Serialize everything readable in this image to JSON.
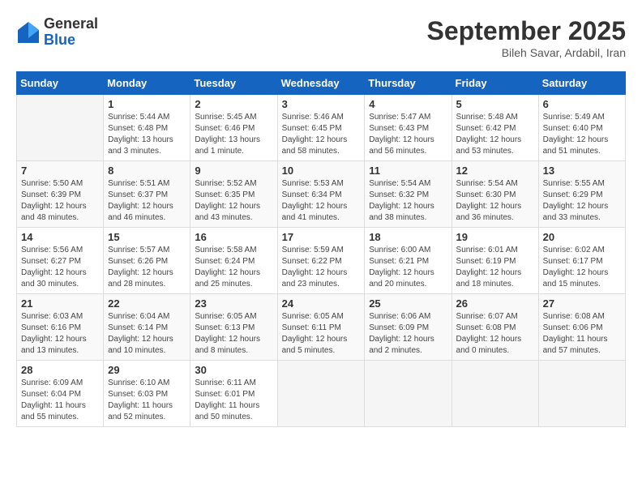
{
  "logo": {
    "general": "General",
    "blue": "Blue"
  },
  "header": {
    "month": "September 2025",
    "location": "Bileh Savar, Ardabil, Iran"
  },
  "weekdays": [
    "Sunday",
    "Monday",
    "Tuesday",
    "Wednesday",
    "Thursday",
    "Friday",
    "Saturday"
  ],
  "weeks": [
    [
      {
        "day": "",
        "info": ""
      },
      {
        "day": "1",
        "info": "Sunrise: 5:44 AM\nSunset: 6:48 PM\nDaylight: 13 hours\nand 3 minutes."
      },
      {
        "day": "2",
        "info": "Sunrise: 5:45 AM\nSunset: 6:46 PM\nDaylight: 13 hours\nand 1 minute."
      },
      {
        "day": "3",
        "info": "Sunrise: 5:46 AM\nSunset: 6:45 PM\nDaylight: 12 hours\nand 58 minutes."
      },
      {
        "day": "4",
        "info": "Sunrise: 5:47 AM\nSunset: 6:43 PM\nDaylight: 12 hours\nand 56 minutes."
      },
      {
        "day": "5",
        "info": "Sunrise: 5:48 AM\nSunset: 6:42 PM\nDaylight: 12 hours\nand 53 minutes."
      },
      {
        "day": "6",
        "info": "Sunrise: 5:49 AM\nSunset: 6:40 PM\nDaylight: 12 hours\nand 51 minutes."
      }
    ],
    [
      {
        "day": "7",
        "info": "Sunrise: 5:50 AM\nSunset: 6:39 PM\nDaylight: 12 hours\nand 48 minutes."
      },
      {
        "day": "8",
        "info": "Sunrise: 5:51 AM\nSunset: 6:37 PM\nDaylight: 12 hours\nand 46 minutes."
      },
      {
        "day": "9",
        "info": "Sunrise: 5:52 AM\nSunset: 6:35 PM\nDaylight: 12 hours\nand 43 minutes."
      },
      {
        "day": "10",
        "info": "Sunrise: 5:53 AM\nSunset: 6:34 PM\nDaylight: 12 hours\nand 41 minutes."
      },
      {
        "day": "11",
        "info": "Sunrise: 5:54 AM\nSunset: 6:32 PM\nDaylight: 12 hours\nand 38 minutes."
      },
      {
        "day": "12",
        "info": "Sunrise: 5:54 AM\nSunset: 6:30 PM\nDaylight: 12 hours\nand 36 minutes."
      },
      {
        "day": "13",
        "info": "Sunrise: 5:55 AM\nSunset: 6:29 PM\nDaylight: 12 hours\nand 33 minutes."
      }
    ],
    [
      {
        "day": "14",
        "info": "Sunrise: 5:56 AM\nSunset: 6:27 PM\nDaylight: 12 hours\nand 30 minutes."
      },
      {
        "day": "15",
        "info": "Sunrise: 5:57 AM\nSunset: 6:26 PM\nDaylight: 12 hours\nand 28 minutes."
      },
      {
        "day": "16",
        "info": "Sunrise: 5:58 AM\nSunset: 6:24 PM\nDaylight: 12 hours\nand 25 minutes."
      },
      {
        "day": "17",
        "info": "Sunrise: 5:59 AM\nSunset: 6:22 PM\nDaylight: 12 hours\nand 23 minutes."
      },
      {
        "day": "18",
        "info": "Sunrise: 6:00 AM\nSunset: 6:21 PM\nDaylight: 12 hours\nand 20 minutes."
      },
      {
        "day": "19",
        "info": "Sunrise: 6:01 AM\nSunset: 6:19 PM\nDaylight: 12 hours\nand 18 minutes."
      },
      {
        "day": "20",
        "info": "Sunrise: 6:02 AM\nSunset: 6:17 PM\nDaylight: 12 hours\nand 15 minutes."
      }
    ],
    [
      {
        "day": "21",
        "info": "Sunrise: 6:03 AM\nSunset: 6:16 PM\nDaylight: 12 hours\nand 13 minutes."
      },
      {
        "day": "22",
        "info": "Sunrise: 6:04 AM\nSunset: 6:14 PM\nDaylight: 12 hours\nand 10 minutes."
      },
      {
        "day": "23",
        "info": "Sunrise: 6:05 AM\nSunset: 6:13 PM\nDaylight: 12 hours\nand 8 minutes."
      },
      {
        "day": "24",
        "info": "Sunrise: 6:05 AM\nSunset: 6:11 PM\nDaylight: 12 hours\nand 5 minutes."
      },
      {
        "day": "25",
        "info": "Sunrise: 6:06 AM\nSunset: 6:09 PM\nDaylight: 12 hours\nand 2 minutes."
      },
      {
        "day": "26",
        "info": "Sunrise: 6:07 AM\nSunset: 6:08 PM\nDaylight: 12 hours\nand 0 minutes."
      },
      {
        "day": "27",
        "info": "Sunrise: 6:08 AM\nSunset: 6:06 PM\nDaylight: 11 hours\nand 57 minutes."
      }
    ],
    [
      {
        "day": "28",
        "info": "Sunrise: 6:09 AM\nSunset: 6:04 PM\nDaylight: 11 hours\nand 55 minutes."
      },
      {
        "day": "29",
        "info": "Sunrise: 6:10 AM\nSunset: 6:03 PM\nDaylight: 11 hours\nand 52 minutes."
      },
      {
        "day": "30",
        "info": "Sunrise: 6:11 AM\nSunset: 6:01 PM\nDaylight: 11 hours\nand 50 minutes."
      },
      {
        "day": "",
        "info": ""
      },
      {
        "day": "",
        "info": ""
      },
      {
        "day": "",
        "info": ""
      },
      {
        "day": "",
        "info": ""
      }
    ]
  ]
}
